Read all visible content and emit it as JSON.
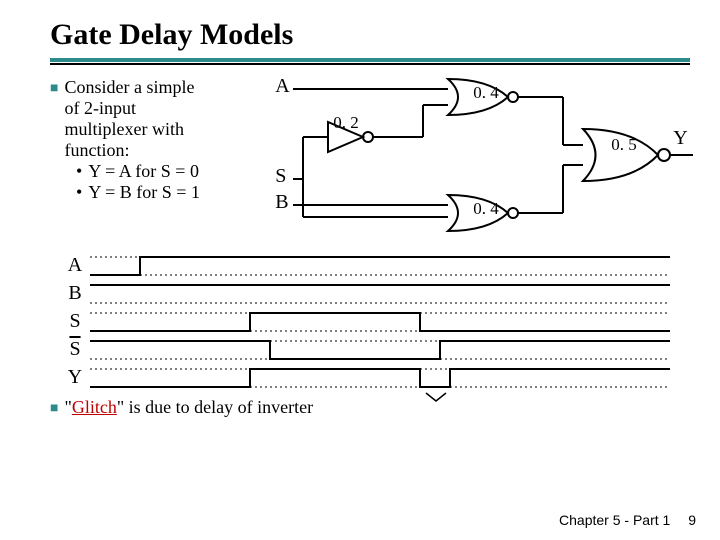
{
  "title": "Gate Delay Models",
  "bullet1": {
    "l1": "Consider a simple",
    "l2": "of 2-input",
    "l3": "multiplexer with",
    "l4": "function:",
    "s1": "Y = A for  S = 0",
    "s2": "Y = B for  S = 1"
  },
  "circuit": {
    "A": "A",
    "B": "B",
    "S": "S",
    "Y": "Y",
    "inv_delay": "0. 2",
    "nor1_delay": "0. 4",
    "nor2_delay": "0. 4",
    "nor3_delay": "0. 5"
  },
  "timing": {
    "A": "A",
    "B": "B",
    "S": "S",
    "Sbar": "S",
    "Y": "Y"
  },
  "bullet2": {
    "pre": "\"",
    "glitch": "Glitch",
    "post": "\" is due to delay of inverter"
  },
  "footer": {
    "chapter": "Chapter 5 - Part 1",
    "page": "9"
  }
}
